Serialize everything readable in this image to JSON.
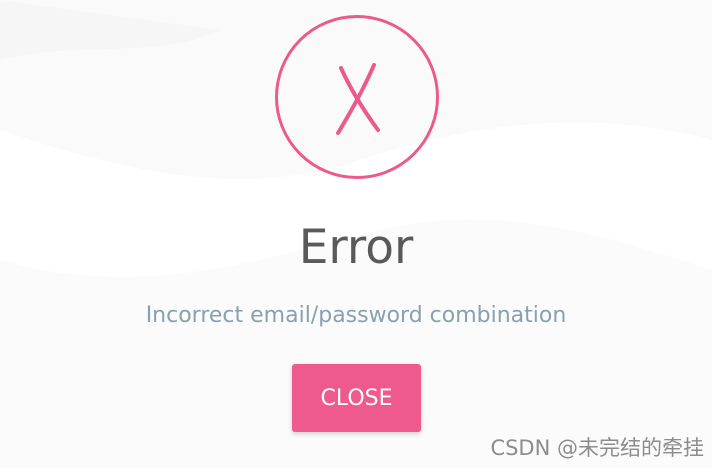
{
  "dialog": {
    "title": "Error",
    "message": "Incorrect email/password combination",
    "close_label": "CLOSE",
    "icon": "x-icon"
  },
  "watermark": {
    "text": "CSDN @未完结的牵挂"
  },
  "colors": {
    "accent": "#ee5a8d",
    "title": "#5a5a5a",
    "message": "#8aa0ae",
    "background": "#ffffff"
  }
}
